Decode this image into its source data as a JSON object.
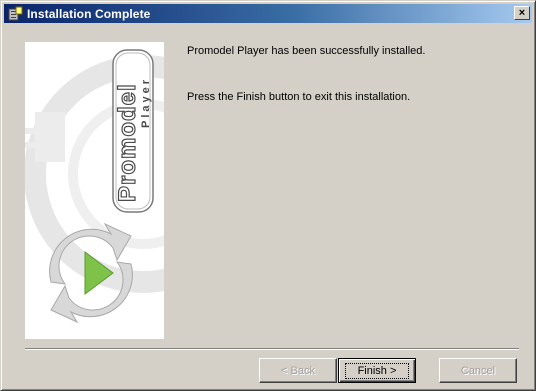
{
  "window": {
    "title": "Installation Complete",
    "close_label": "×"
  },
  "side_panel": {
    "brand_main": "Promodel",
    "brand_sub": "Player"
  },
  "messages": {
    "line1": "Promodel Player has been successfully installed.",
    "line2": "Press the Finish button to exit this installation."
  },
  "buttons": {
    "back": "< Back",
    "finish": "Finish >",
    "cancel": "Cancel"
  },
  "colors": {
    "title_gradient_start": "#0a246a",
    "title_gradient_end": "#a6caf0",
    "dialog_face": "#d4d0c8",
    "arrow_green": "#7fc24a"
  }
}
